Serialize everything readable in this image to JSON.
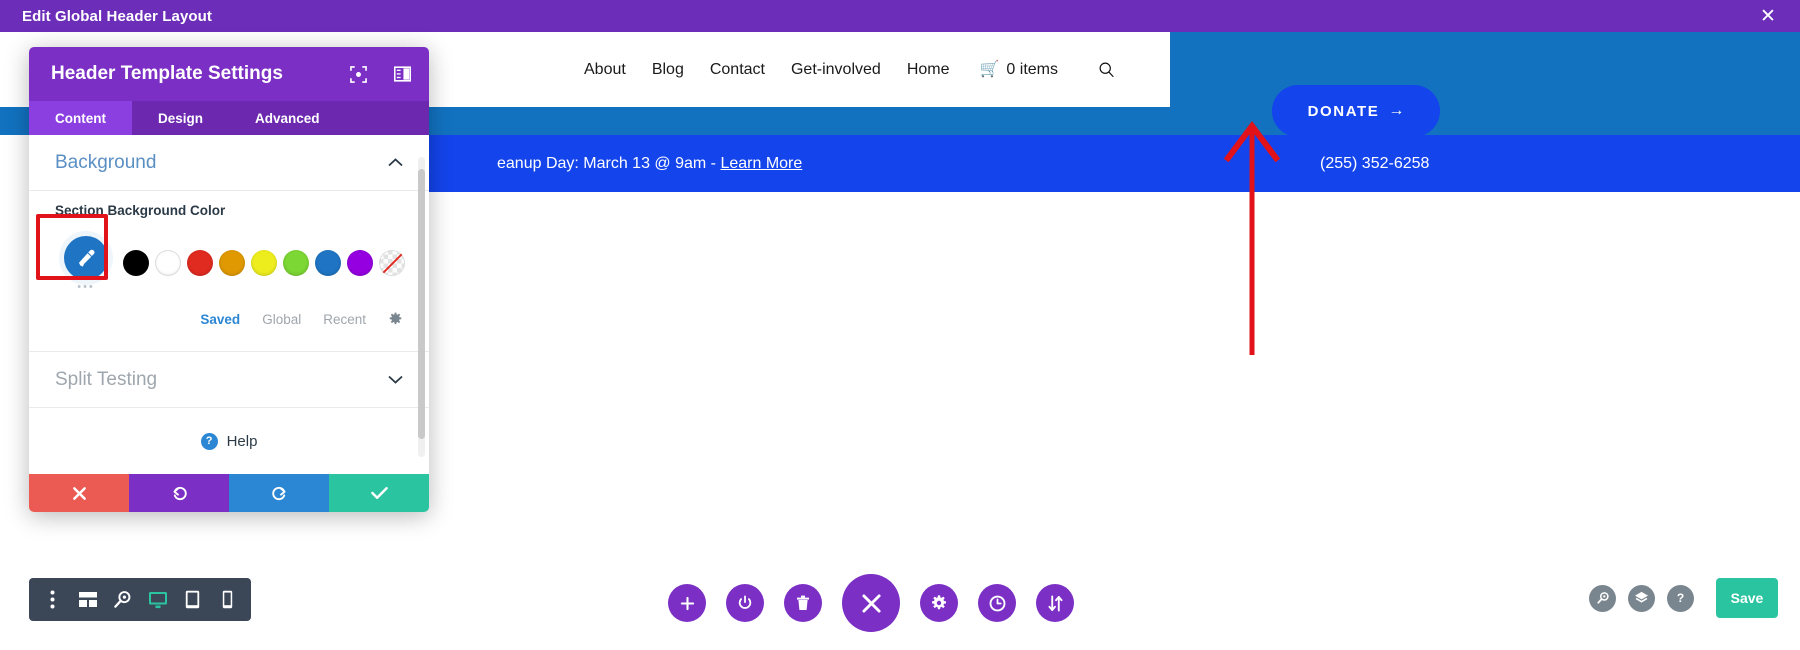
{
  "editor": {
    "title": "Edit Global Header Layout",
    "close_icon": "close-icon",
    "titlebar_color": "#6c2eb9"
  },
  "settings_panel": {
    "title": "Header Template Settings",
    "header_icons": [
      {
        "name": "focus-target-icon"
      },
      {
        "name": "panel-layout-icon"
      }
    ],
    "tabs": [
      {
        "label": "Content",
        "active": true
      },
      {
        "label": "Design",
        "active": false
      },
      {
        "label": "Advanced",
        "active": false
      }
    ],
    "sections": [
      {
        "title": "Background",
        "expanded": true,
        "chevron": "chevron-up-icon"
      },
      {
        "title": "Split Testing",
        "expanded": false,
        "chevron": "chevron-down-icon"
      }
    ],
    "background": {
      "field_label": "Section Background Color",
      "picker": {
        "name": "color-picker-eyedropper",
        "color": "#1f75c4",
        "more_dots": "•••"
      },
      "swatches": [
        {
          "name": "swatch-black",
          "color": "#000000"
        },
        {
          "name": "swatch-white",
          "color": "#ffffff"
        },
        {
          "name": "swatch-red",
          "color": "#e02b20"
        },
        {
          "name": "swatch-orange",
          "color": "#e09900"
        },
        {
          "name": "swatch-yellow",
          "color": "#eded1e"
        },
        {
          "name": "swatch-green",
          "color": "#7cd634"
        },
        {
          "name": "swatch-blue",
          "color": "#1f75c4"
        },
        {
          "name": "swatch-purple",
          "color": "#9500e0"
        },
        {
          "name": "swatch-transparent",
          "color": "transparent"
        }
      ],
      "color_tabs": [
        {
          "label": "Saved",
          "active": true
        },
        {
          "label": "Global",
          "active": false
        },
        {
          "label": "Recent",
          "active": false
        }
      ],
      "settings_gear": "gear-icon"
    },
    "help": {
      "label": "Help",
      "badge": "?"
    },
    "actions": [
      {
        "name": "cancel-button",
        "icon": "close-icon",
        "color": "#ec5a54"
      },
      {
        "name": "undo-button",
        "icon": "undo-icon",
        "color": "#7b2fc4"
      },
      {
        "name": "redo-button",
        "icon": "redo-icon",
        "color": "#2b87d4"
      },
      {
        "name": "confirm-button",
        "icon": "check-icon",
        "color": "#2bc4a0"
      }
    ]
  },
  "site": {
    "nav": [
      {
        "label": "About"
      },
      {
        "label": "Blog"
      },
      {
        "label": "Contact"
      },
      {
        "label": "Get-involved"
      },
      {
        "label": "Home"
      }
    ],
    "cart": {
      "icon": "cart-icon",
      "count_label": "0 items"
    },
    "search_icon": "search-icon",
    "donate": {
      "label": "DONATE",
      "arrow": "→",
      "color": "#1444ec"
    },
    "announcement": {
      "text_prefix": "eanup Day: March 13 @ 9am - ",
      "link": "Learn More"
    },
    "phone": "(255) 352-6258",
    "topstrip_color": "#1272c0",
    "announce_color": "#1444ec"
  },
  "device_toolbar": [
    {
      "name": "more-options-icon"
    },
    {
      "name": "wireframe-icon"
    },
    {
      "name": "zoom-icon"
    },
    {
      "name": "desktop-icon",
      "active": true
    },
    {
      "name": "tablet-icon"
    },
    {
      "name": "mobile-icon"
    }
  ],
  "center_tools": [
    {
      "name": "add-icon"
    },
    {
      "name": "power-icon"
    },
    {
      "name": "trash-icon"
    },
    {
      "name": "close-icon",
      "big": true
    },
    {
      "name": "gear-icon"
    },
    {
      "name": "history-clock-icon"
    },
    {
      "name": "sort-arrows-icon"
    }
  ],
  "right_tools": [
    {
      "name": "search-icon"
    },
    {
      "name": "layers-icon"
    },
    {
      "name": "help-icon",
      "glyph": "?"
    }
  ],
  "save_button": {
    "label": "Save",
    "color": "#2bc4a0"
  },
  "annotation": {
    "arrow_color": "#e1121a",
    "redbox_color": "#e1121a"
  }
}
